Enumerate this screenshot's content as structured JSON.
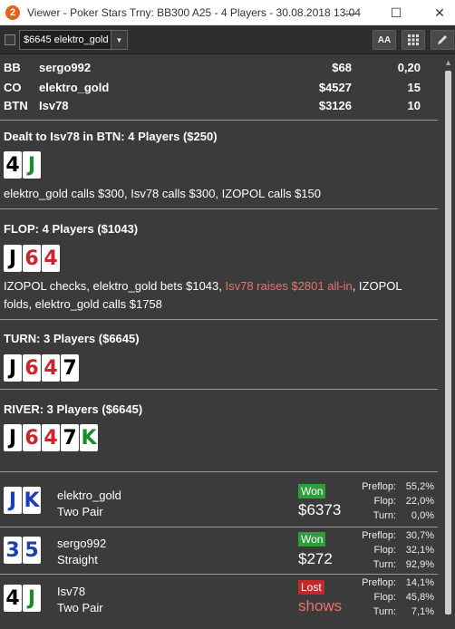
{
  "window": {
    "app_icon_glyph": "2",
    "title": "Viewer - Poker Stars Trny: BB300 A25 - 4 Players - 30.08.2018 13:04",
    "minimize": "—",
    "maximize": "☐",
    "close": "✕"
  },
  "toolbar": {
    "hand_select_value": "$6645 elektro_gold",
    "font_button": "AA",
    "grid_icon": "grid-icon",
    "pen_icon": "pen-icon"
  },
  "seats": [
    {
      "pos": "BB",
      "name": "sergo992",
      "stack": "$68",
      "bb": "0,20"
    },
    {
      "pos": "CO",
      "name": "elektro_gold",
      "stack": "$4527",
      "bb": "15"
    },
    {
      "pos": "BTN",
      "name": "Isv78",
      "stack": "$3126",
      "bb": "10"
    }
  ],
  "preflop": {
    "title": "Dealt to Isv78 in BTN: 4 Players ($250)",
    "cards": [
      {
        "rank": "4",
        "suit": "s"
      },
      {
        "rank": "J",
        "suit": "c"
      }
    ],
    "actions": "elektro_gold calls $300, Isv78 calls $300, IZOPOL calls $150"
  },
  "flop": {
    "title": "FLOP: 4 Players ($1043)",
    "cards": [
      {
        "rank": "J",
        "suit": "s"
      },
      {
        "rank": "6",
        "suit": "h"
      },
      {
        "rank": "4",
        "suit": "h"
      }
    ],
    "actions_part1": "IZOPOL checks, elektro_gold bets $1043, ",
    "actions_raise": "Isv78 raises $2801 all-in",
    "actions_part2": ", IZOPOL folds, elektro_gold calls $1758"
  },
  "turn": {
    "title": "TURN: 3 Players ($6645)",
    "cards": [
      {
        "rank": "J",
        "suit": "s"
      },
      {
        "rank": "6",
        "suit": "h"
      },
      {
        "rank": "4",
        "suit": "h"
      },
      {
        "rank": "7",
        "suit": "s"
      }
    ]
  },
  "river": {
    "title": "RIVER: 3 Players ($6645)",
    "cards": [
      {
        "rank": "J",
        "suit": "s"
      },
      {
        "rank": "6",
        "suit": "h"
      },
      {
        "rank": "4",
        "suit": "h"
      },
      {
        "rank": "7",
        "suit": "s"
      },
      {
        "rank": "K",
        "suit": "c"
      }
    ]
  },
  "results": [
    {
      "cards": [
        {
          "rank": "J",
          "suit": "d"
        },
        {
          "rank": "K",
          "suit": "d"
        }
      ],
      "name": "elektro_gold",
      "hand": "Two Pair",
      "badge": "Won",
      "amount": "$6373",
      "preflop": "55,2%",
      "flop": "22,0%",
      "turn": "0,0%"
    },
    {
      "cards": [
        {
          "rank": "3",
          "suit": "d"
        },
        {
          "rank": "5",
          "suit": "d"
        }
      ],
      "name": "sergo992",
      "hand": "Straight",
      "badge": "Won",
      "amount": "$272",
      "preflop": "30,7%",
      "flop": "32,1%",
      "turn": "92,9%"
    },
    {
      "cards": [
        {
          "rank": "4",
          "suit": "s"
        },
        {
          "rank": "J",
          "suit": "c"
        }
      ],
      "name": "Isv78",
      "hand": "Two Pair",
      "badge": "Lost",
      "amount": "shows",
      "preflop": "14,1%",
      "flop": "45,8%",
      "turn": "7,1%"
    }
  ],
  "equity_labels": {
    "preflop": "Preflop:",
    "flop": "Flop:",
    "turn": "Turn:"
  },
  "colors": {
    "won": "#2d9e3a",
    "lost": "#c02a2a",
    "raise_text": "#e8736a",
    "hearts": "#c8252c",
    "clubs": "#1a8a2a",
    "diamonds": "#1d3fb5",
    "spades": "#000000"
  }
}
